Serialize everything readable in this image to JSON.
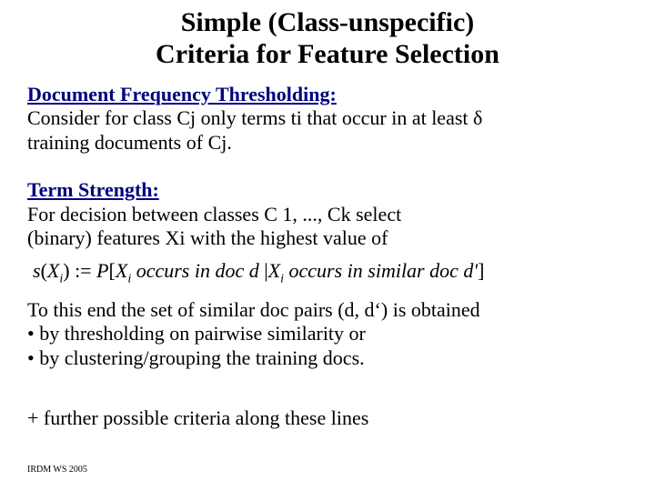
{
  "title_line1": "Simple (Class-unspecific)",
  "title_line2": "Criteria for Feature Selection",
  "dft": {
    "heading": "Document Frequency Thresholding:",
    "line1": "Consider for class Cj only terms ti that occur in at least δ",
    "line2": "training documents of Cj."
  },
  "ts": {
    "heading": "Term Strength:",
    "line1": "For decision between classes C 1, ..., Ck select",
    "line2": "(binary) features Xi with the highest value of"
  },
  "formula": {
    "s": "s",
    "lp": "(",
    "X": "X",
    "i": "i",
    "rp": ")",
    "def": " := ",
    "P": "P",
    "lb": "[",
    "X2": "X",
    "i2": "i",
    "mid1": " occurs in doc d  ",
    "bar": "|",
    "X3": "X",
    "i3": "i",
    "mid2": " occurs in similar doc d'",
    "rb": "]"
  },
  "tail": {
    "line1": "To this end the set of similar doc pairs (d, d‘) is obtained",
    "line2": "• by thresholding on pairwise similarity or",
    "line3": "• by clustering/grouping the training docs."
  },
  "plus": "+ further possible criteria along these lines",
  "footer": "IRDM  WS 2005"
}
